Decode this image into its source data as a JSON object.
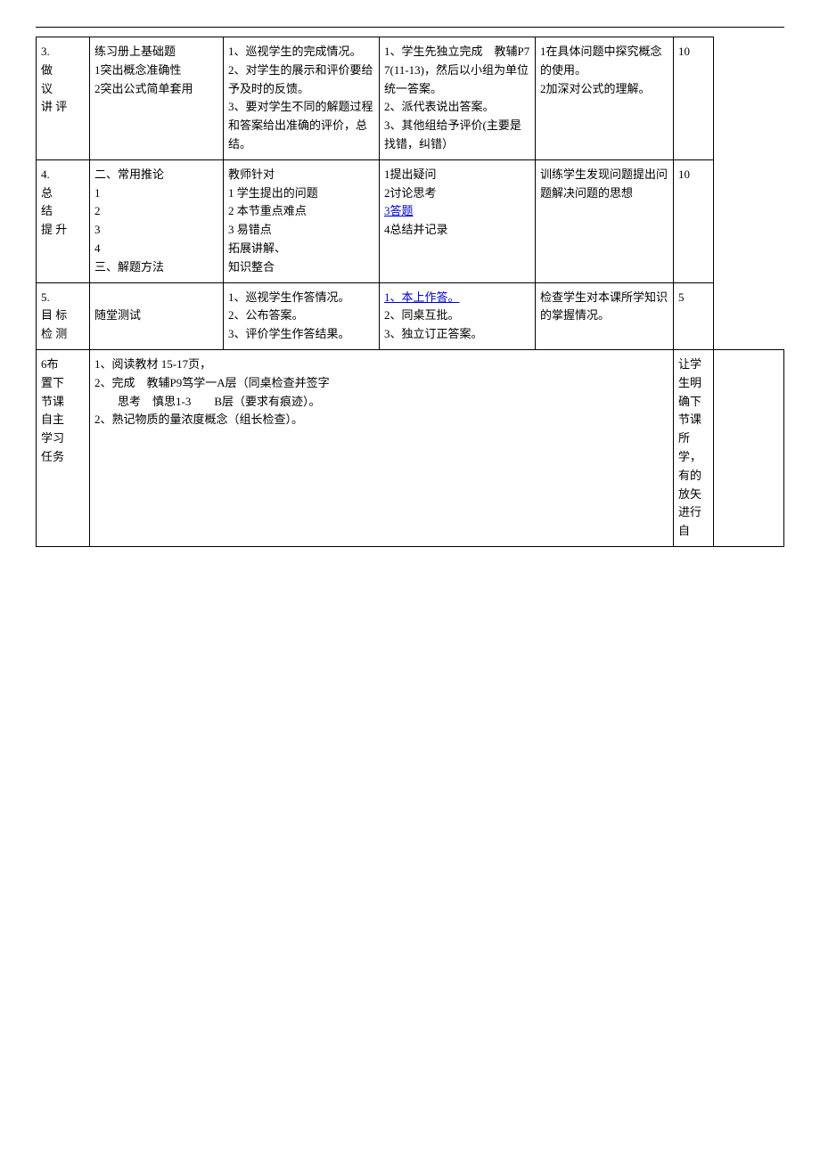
{
  "page": {
    "topLine": true
  },
  "table": {
    "rows": [
      {
        "id": "row1",
        "col1": "3.\n做\n议\n讲 评",
        "col2": "练习册上基础题\n1突出概念准确性\n2突出公式简单套用",
        "col3": "1、巡视学生的完成情况。\n2、对学生的展示和评价要给予及时的反馈。\n3、要对学生不同的解题过程和答案给出准确的评价，总结。",
        "col4": "1、学生先独立完成　教辅P77(11-13)，然后以小组为单位统一答案。\n2、派代表说出答案。\n3、其他组给予评价(主要是找错，纠错）",
        "col5": "1在具体问题中探究概念的使用。\n2加深对公式的理解。",
        "col6": "10"
      },
      {
        "id": "row2",
        "col1": "4.\n总\n结\n提 升",
        "col2": "二、常用推论\n1\n2\n3\n4\n三、解题方法",
        "col3": "教师针对\n1 学生提出的问题\n2 本节重点难点\n3 易错点\n拓展讲解、\n知识整合",
        "col4": "1提出疑问\n2讨论思考\n3答题\n4总结并记录",
        "col5": "训练学生发现问题提出问题解决问题的思想",
        "col6": "10",
        "col4_link": "3答题"
      },
      {
        "id": "row3",
        "col1": "5.\n目 标\n检 测",
        "col2": "\n随堂测试",
        "col3": "1、巡视学生作答情况。\n2、公布答案。\n3、评价学生作答结果。",
        "col4": "1、本上作答。\n2、同桌互批。\n3、独立订正答案。",
        "col5": "检查学生对本课所学知识的掌握情况。",
        "col6": "5",
        "col4_link1": "1、本上作答。"
      },
      {
        "id": "row4",
        "col1": "6布\n置下\n节课\n自主\n学习\n任务",
        "col2": "1、阅读教材 15-17页，\n2、完成　教辅P9笃学一A层（同桌检查并签字\n　　思考　慎思1-3　　B层（要求有痕迹）。\n2、熟记物质的量浓度概念（组长检查）。",
        "col3": "",
        "col4": "",
        "col5": "让学生明确下节课所学，有的放矢进行自",
        "col6": ""
      }
    ]
  }
}
